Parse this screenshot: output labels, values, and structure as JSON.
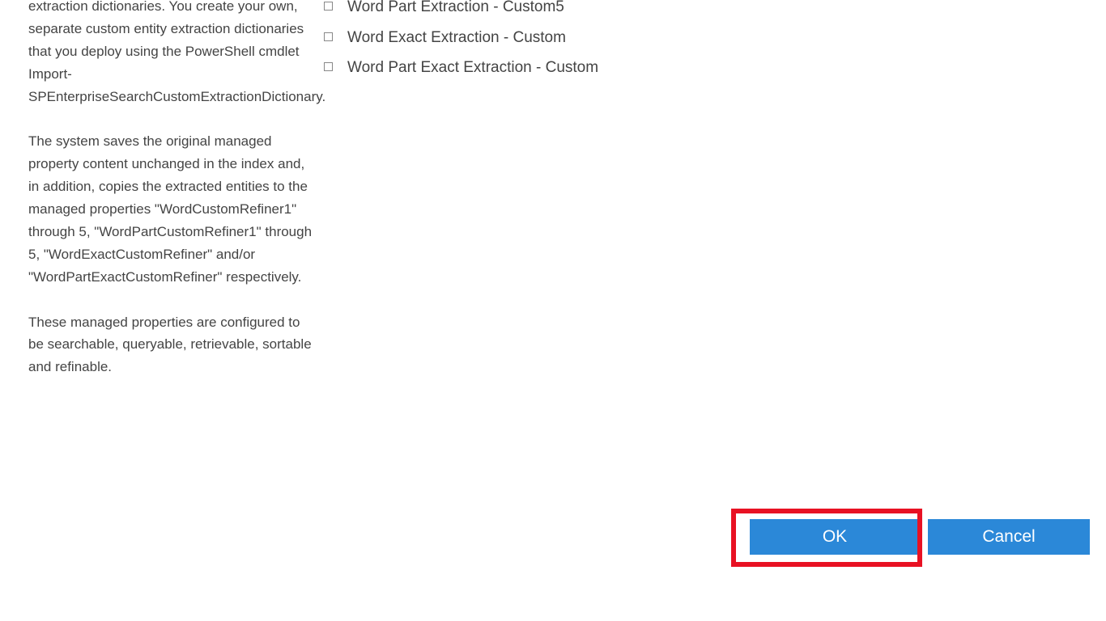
{
  "description": {
    "para1": "extraction dictionaries. You create your own, separate custom entity extraction dictionaries that you deploy using the PowerShell cmdlet Import-SPEnterpriseSearchCustomExtractionDictionary.",
    "para2": "The system saves the original managed property content unchanged in the index and, in addition, copies the extracted entities to the managed properties  \"WordCustomRefiner1\" through 5, \"WordPartCustomRefiner1\" through 5, \"WordExactCustomRefiner\" and/or \"WordPartExactCustomRefiner\" respectively.",
    "para3": "These managed properties are configured to be searchable, queryable, retrievable, sortable and refinable."
  },
  "checkboxes": [
    {
      "label": "Word Part Extraction - Custom5"
    },
    {
      "label": "Word Exact Extraction - Custom"
    },
    {
      "label": "Word Part Exact Extraction - Custom"
    }
  ],
  "buttons": {
    "ok": "OK",
    "cancel": "Cancel"
  },
  "colors": {
    "button_bg": "#2b88d8",
    "highlight": "#e81123"
  }
}
